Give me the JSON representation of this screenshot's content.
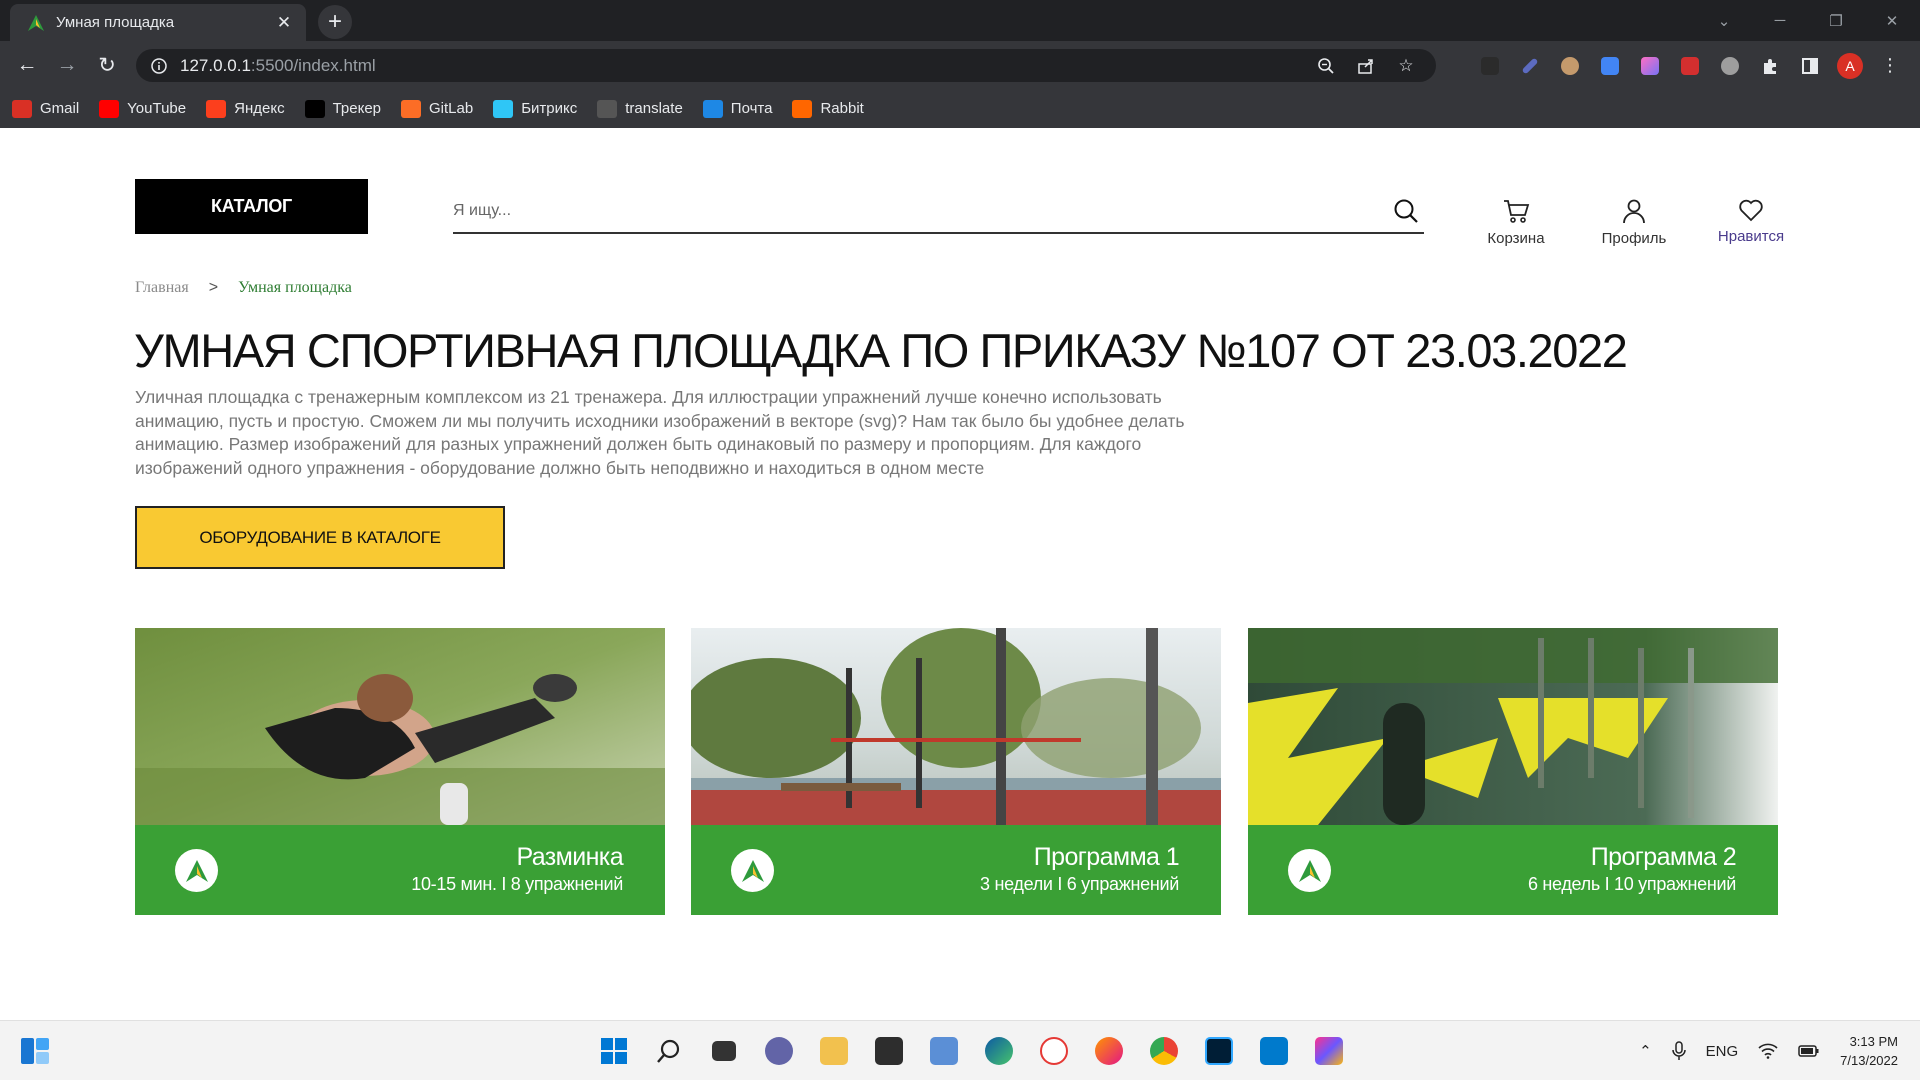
{
  "browser": {
    "tab_title": "Умная площадка",
    "url_host": "127.0.0.1",
    "url_rest": ":5500/index.html",
    "bookmarks": [
      {
        "label": "Gmail",
        "color": "#d93025"
      },
      {
        "label": "YouTube",
        "color": "#ff0000"
      },
      {
        "label": "Яндекс",
        "color": "#fc3f1d"
      },
      {
        "label": "Трекер",
        "color": "#000000"
      },
      {
        "label": "GitLab",
        "color": "#fc6d26"
      },
      {
        "label": "Битрикс",
        "color": "#2fc6f6"
      },
      {
        "label": "translate",
        "color": "#555555"
      },
      {
        "label": "Почта",
        "color": "#1e88e5"
      },
      {
        "label": "Rabbit",
        "color": "#ff6600"
      }
    ]
  },
  "header": {
    "catalog_label": "КАТАЛОГ",
    "search_placeholder": "Я ищу...",
    "cart_label": "Корзина",
    "profile_label": "Профиль",
    "favorites_label": "Нравится"
  },
  "breadcrumb": {
    "home": "Главная",
    "separator": ">",
    "current": "Умная площадка"
  },
  "main": {
    "title": "УМНАЯ СПОРТИВНАЯ ПЛОЩАДКА ПО ПРИКАЗУ №107 ОТ 23.03.2022",
    "description": "Уличная площадка с тренажерным комплексом из 21 тренажера. Для иллюстрации упражнений лучше конечно использовать анимацию, пусть и простую. Сможем ли мы получить исходники изображений в векторе (svg)? Нам так было бы удобнее делать анимацию. Размер изображений для разных упражнений должен быть одинаковый по размеру и пропорциям. Для каждого изображений одного упражнения - оборудование должно быть неподвижно и находиться в одном месте",
    "equipment_button": "ОБОРУДОВАНИЕ В КАТАЛОГЕ"
  },
  "cards": [
    {
      "title": "Разминка",
      "subtitle": "10-15 мин. I 8 упражнений"
    },
    {
      "title": "Программа 1",
      "subtitle": "3 недели I 6 упражнений"
    },
    {
      "title": "Программа 2",
      "subtitle": "6 недель I 10 упражнений"
    }
  ],
  "colors": {
    "accent_green": "#3aa035",
    "button_yellow": "#f9c932",
    "catalog_black": "#000000"
  },
  "taskbar": {
    "language": "ENG",
    "time": "3:13 PM",
    "date": "7/13/2022"
  }
}
